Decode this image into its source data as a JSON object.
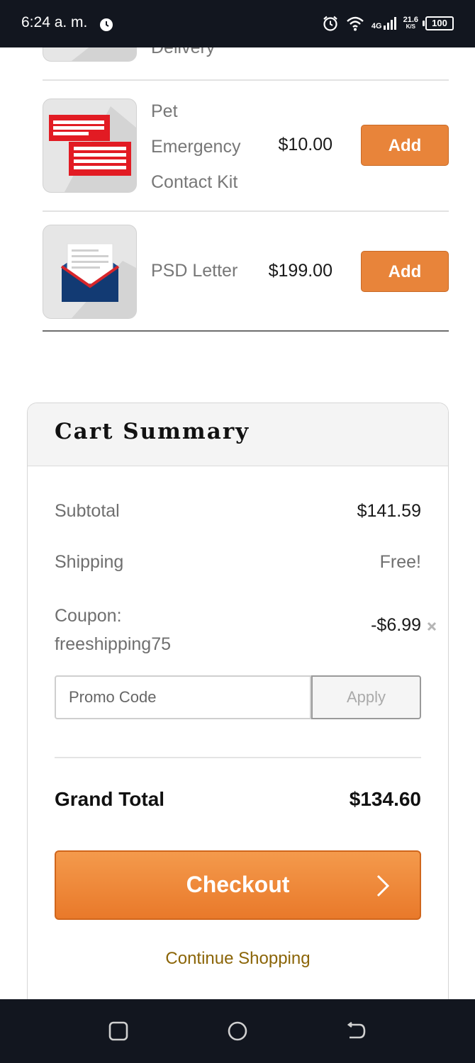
{
  "status_bar": {
    "time": "6:24 a. m.",
    "network": "4G",
    "speed_value": "21.6",
    "speed_unit": "K/S",
    "battery": "100"
  },
  "products": [
    {
      "name": "Delivery",
      "icon": "delivery-icon"
    },
    {
      "name_lines": [
        "Pet",
        "Emergency",
        "Contact Kit"
      ],
      "price": "$10.00",
      "button": "Add",
      "icon": "contact-cards-icon"
    },
    {
      "name": "PSD Letter",
      "price": "$199.00",
      "button": "Add",
      "icon": "envelope-letter-icon"
    }
  ],
  "cart_summary": {
    "title": "Cart Summary",
    "subtotal_label": "Subtotal",
    "subtotal_value": "$141.59",
    "shipping_label": "Shipping",
    "shipping_value": "Free!",
    "coupon_label_line1": "Coupon:",
    "coupon_label_line2": "freeshipping75",
    "coupon_value": "-$6.99",
    "promo_placeholder": "Promo Code",
    "apply_label": "Apply",
    "grand_total_label": "Grand Total",
    "grand_total_value": "$134.60",
    "checkout_label": "Checkout",
    "continue_label": "Continue Shopping"
  },
  "colors": {
    "accent": "#e8843a",
    "link": "#8b6508",
    "system_bar": "#12161f"
  }
}
